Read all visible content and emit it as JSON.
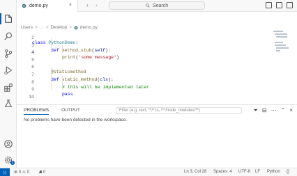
{
  "tab": {
    "file_name": "demo.py",
    "close": "×"
  },
  "nav": {
    "back": "‹",
    "forward": "›"
  },
  "search": {
    "label": "Search"
  },
  "breadcrumb": {
    "parts": [
      "Users",
      "Desktop",
      "demo.py"
    ],
    "separator": ">"
  },
  "editor": {
    "lines": [
      {
        "n": "2"
      },
      {
        "n": "3"
      },
      {
        "n": "4"
      },
      {
        "n": "5"
      },
      {
        "n": "6"
      },
      {
        "n": "7"
      },
      {
        "n": "8"
      },
      {
        "n": "9"
      },
      {
        "n": "10"
      }
    ],
    "tokens": {
      "l2_class": "class ",
      "l2_name": "PythonDemo",
      "l2_rest": ":",
      "l3_def": "def ",
      "l3_fn": "method_stub",
      "l3_p1": "(",
      "l3_self": "self",
      "l3_p2": "):",
      "l4_fn": "print",
      "l4_p1": "(",
      "l4_str": "'some message'",
      "l4_p2": ")",
      "l6_deco": "@staticmethod",
      "l7_def": "def ",
      "l7_fn": "static_method",
      "l7_p1": "(",
      "l7_arg": "cls",
      "l7_p2": "):",
      "l8_cmt": "# this will be implemented later",
      "l9_kw": "pass"
    }
  },
  "panel": {
    "tabs": [
      "PROBLEMS",
      "OUTPUT"
    ],
    "filter_placeholder": "Filter (e.g. text, **/*.ts, !**/node_modules/**)",
    "message": "No problems have been detected in the workspace."
  },
  "status": {
    "errors": "⊗ 0 ⚠ 0",
    "ports": "⛘ 0",
    "position": "Ln 3, Col 28",
    "spaces": "Spaces: 4",
    "encoding": "UTF-8",
    "eol": "LF",
    "language": "Python",
    "feedback": "{}"
  },
  "badge": {
    "count": "1"
  },
  "colors": {
    "accent": "#005fb8"
  }
}
